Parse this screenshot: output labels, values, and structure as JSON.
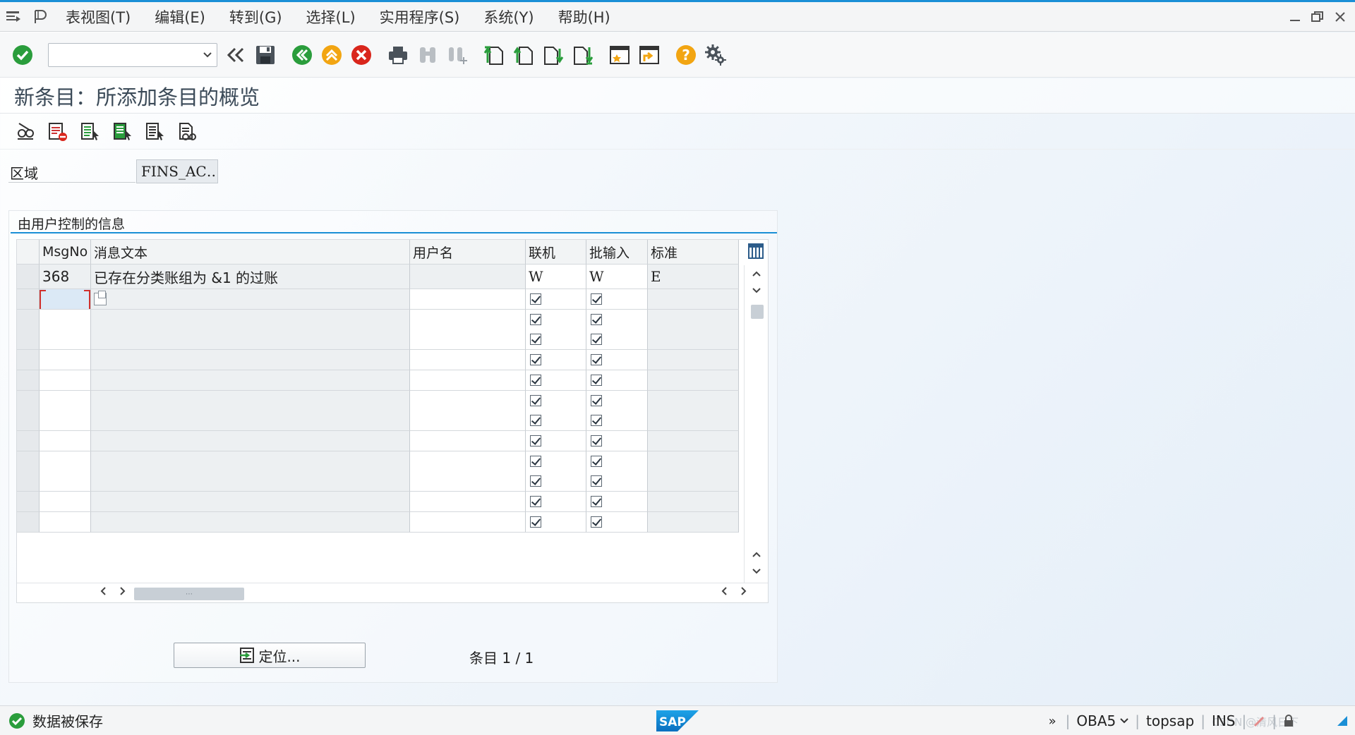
{
  "menubar": {
    "items": [
      "表视图(T)",
      "编辑(E)",
      "转到(G)",
      "选择(L)",
      "实用程序(S)",
      "系统(Y)",
      "帮助(H)"
    ]
  },
  "toolbar": {
    "command_value": ""
  },
  "screen": {
    "title": "新条目：所添加条目的概览"
  },
  "area": {
    "label": "区域",
    "value": "FINS_AC…"
  },
  "group": {
    "title": "由用户控制的信息"
  },
  "table": {
    "headers": {
      "msgno": "MsgNo",
      "text": "消息文本",
      "user": "用户名",
      "online": "联机",
      "batch": "批输入",
      "standard": "标准"
    },
    "rows": [
      {
        "msgno": "368",
        "text": "已存在分类账组为 &1 的过账",
        "user": "",
        "online": "W",
        "batch": "W",
        "standard": "E"
      }
    ],
    "empty_rows": 12,
    "empty_online_checked": true,
    "empty_batch_checked": true
  },
  "footer": {
    "position_button": "定位...",
    "entries_label": "条目",
    "entries_value": "1 / 1"
  },
  "statusbar": {
    "message": "数据被保存",
    "transaction": "OBA5",
    "system": "topsap",
    "mode": "INS",
    "watermark": "CSDN @清风日下"
  },
  "colors": {
    "accent": "#1a8fd6",
    "ok_green": "#2a9d3c",
    "exit_orange": "#f2a512",
    "cancel_red": "#d9261c",
    "help_yellow": "#f2a512"
  }
}
